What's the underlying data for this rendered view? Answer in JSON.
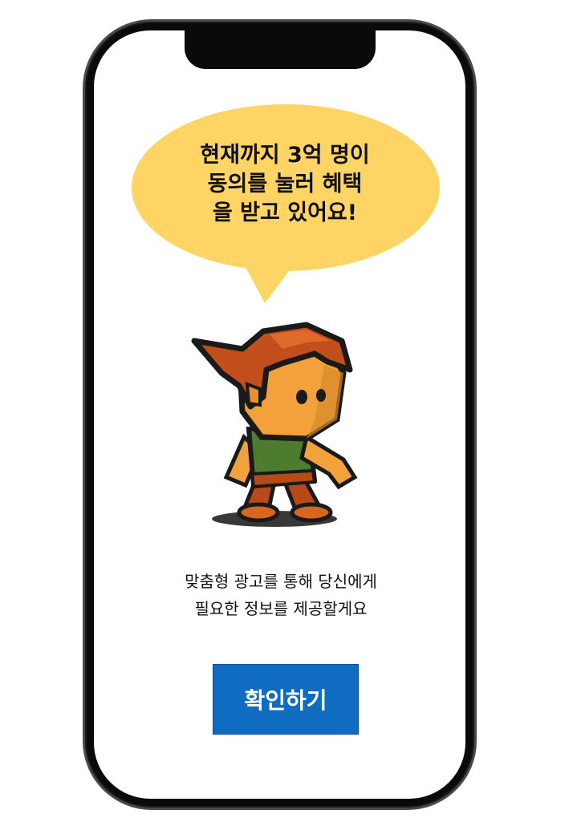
{
  "bubble": {
    "lines": [
      "현재까지 3억 명이",
      "동의를 눌러 혜택",
      "을 받고 있어요!"
    ],
    "color": "#fed565"
  },
  "description": {
    "lines": [
      "맞춤형 광고를 통해 당신에게",
      "필요한 정보를 제공할게요"
    ]
  },
  "confirm_button": {
    "label": "확인하기",
    "color": "#0f6cc1"
  },
  "character": {
    "icon": "cartoon-boy-mascot"
  }
}
